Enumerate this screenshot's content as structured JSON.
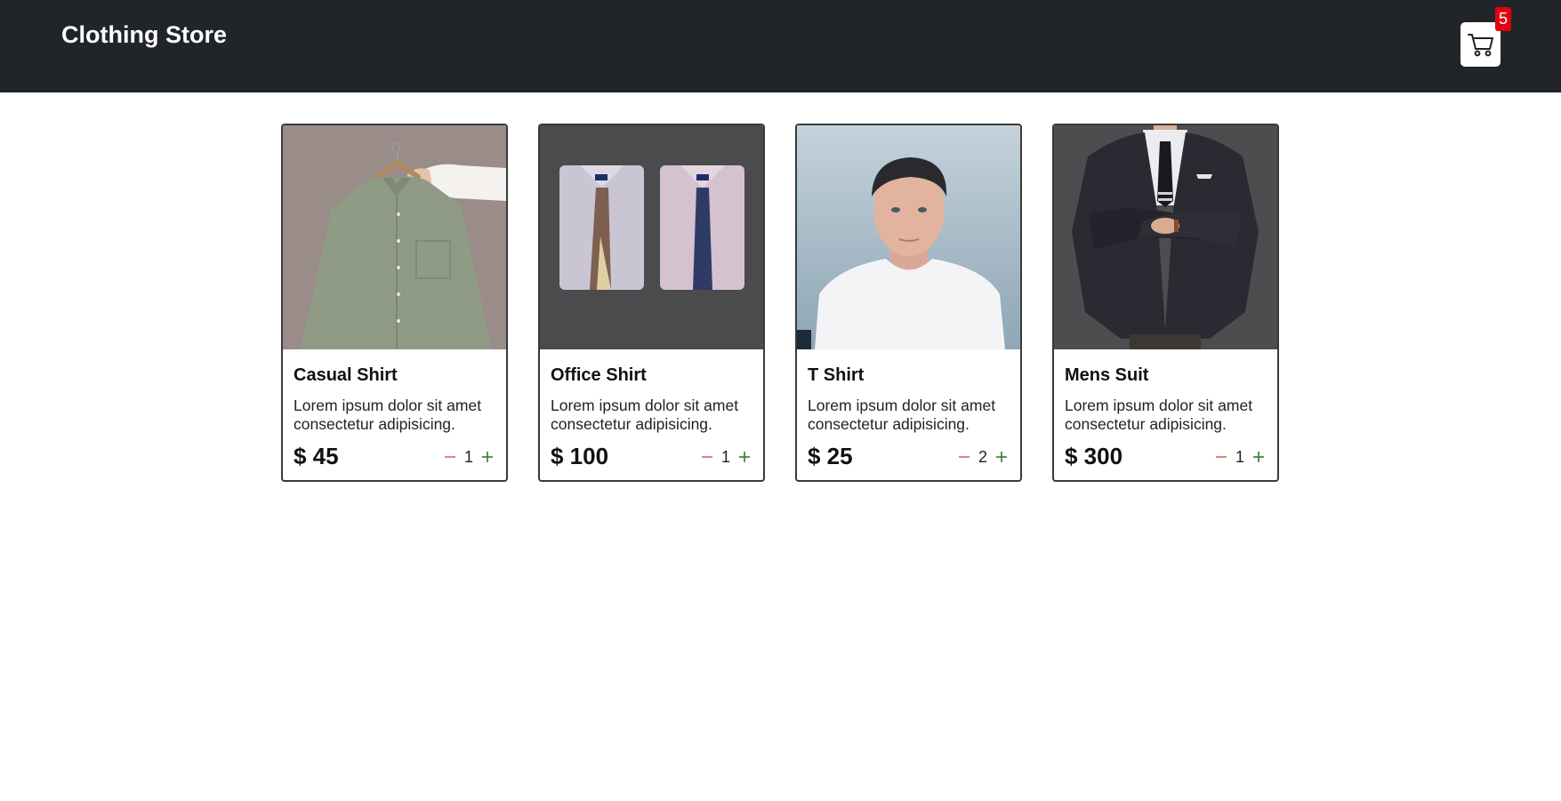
{
  "header": {
    "brand": "Clothing Store",
    "cart_count": "5",
    "cart_icon": "shopping-cart-icon"
  },
  "products": [
    {
      "title": "Casual Shirt",
      "description": "Lorem ipsum dolor sit amet consectetur adipisicing.",
      "price": "$ 45",
      "quantity": "1",
      "image": "green-casual-shirt-on-hanger"
    },
    {
      "title": "Office Shirt",
      "description": "Lorem ipsum dolor sit amet consectetur adipisicing.",
      "price": "$ 100",
      "quantity": "1",
      "image": "folded-office-shirts-with-ties"
    },
    {
      "title": "T Shirt",
      "description": "Lorem ipsum dolor sit amet consectetur adipisicing.",
      "price": "$ 25",
      "quantity": "2",
      "image": "man-in-white-t-shirt"
    },
    {
      "title": "Mens Suit",
      "description": "Lorem ipsum dolor sit amet consectetur adipisicing.",
      "price": "$ 300",
      "quantity": "1",
      "image": "man-in-dark-suit"
    }
  ],
  "colors": {
    "navbar": "#212529",
    "badge": "#e3000f",
    "minus": "#e57373",
    "plus": "#2e7d32"
  }
}
